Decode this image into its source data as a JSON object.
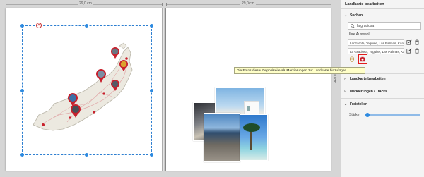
{
  "rulers": {
    "left_width": "29,0 cm",
    "right_width": "29,0 cm",
    "height": "29,0 cm"
  },
  "panel": {
    "title": "Landkarte bearbeiten",
    "search": {
      "section_label": "Suchen",
      "query": "la graciosa",
      "selection_label": "Ihre Auswahl",
      "results": [
        "Lanzarote, Teguise, Las Palmas, Kana",
        "La Graciosa, Teguise, Las Palmas, Ka"
      ]
    },
    "sections": {
      "edit_map": "Landkarte bearbeiten",
      "markers_tracks": "Markierungen / Tracks",
      "cutout": "Freistellen"
    },
    "cutout": {
      "strength_label": "Stärke:",
      "strength_value": 0.0
    }
  },
  "tooltip": "Die Fotos dieser Doppelseite als Markierungen zur Landkarte hinzufügen",
  "icons": {
    "search": "search-icon",
    "edit": "edit-icon",
    "delete": "trash-icon",
    "marker_add": "map-marker-icon",
    "photos_to_map": "photo-marker-add-icon"
  },
  "colors": {
    "selection": "#2d7fd1",
    "highlight": "#e21c1c",
    "tooltip_bg": "#ffffc8",
    "pin": "#c8202c"
  }
}
